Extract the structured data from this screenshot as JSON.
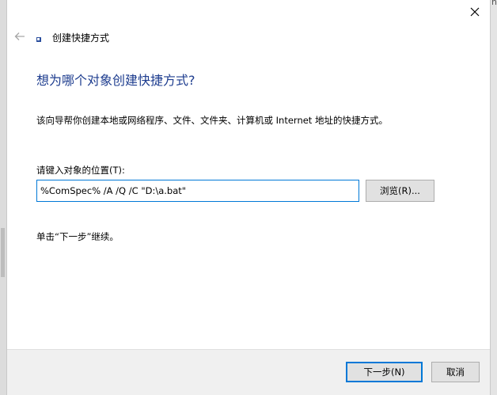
{
  "wizard": {
    "title": "创建快捷方式",
    "heading": "想为哪个对象创建快捷方式?",
    "description": "该向导帮你创建本地或网络程序、文件、文件夹、计算机或 Internet 地址的快捷方式。",
    "location_label": "请键入对象的位置(T):",
    "location_value": "%ComSpec% /A /Q /C \"D:\\a.bat\"",
    "browse_label": "浏览(R)...",
    "hint": "单击“下一步”继续。",
    "next_label": "下一步(N)",
    "cancel_label": "取消"
  },
  "background": {
    "corner_glyph": "n"
  },
  "icons": {
    "close": "close-icon",
    "back": "back-arrow-icon",
    "wizard": "shortcut-icon"
  },
  "colors": {
    "heading": "#1e3d8f",
    "focus_border": "#0078d7",
    "button_bg": "#e1e1e1",
    "footer_bg": "#f0f0f0"
  }
}
